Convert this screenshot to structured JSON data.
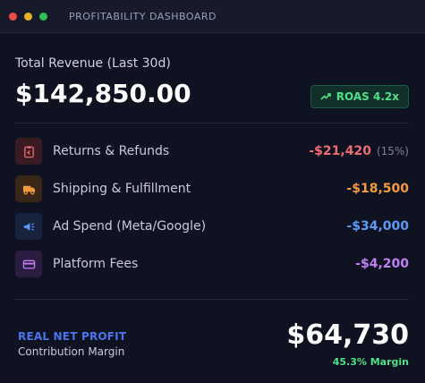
{
  "window": {
    "title": "PROFITABILITY DASHBOARD"
  },
  "summary": {
    "total_label": "Total Revenue (Last 30d)",
    "total_value": "$142,850.00",
    "roas_label": "ROAS 4.2x"
  },
  "costs": [
    {
      "label": "Returns & Refunds",
      "amount": "-$21,420",
      "pct": "(15%)",
      "icon": "return-receipt-icon",
      "color": "#ef6b73"
    },
    {
      "label": "Shipping & Fulfillment",
      "amount": "-$18,500",
      "icon": "truck-icon",
      "color": "#f59a3f"
    },
    {
      "label": "Ad Spend (Meta/Google)",
      "amount": "-$34,000",
      "icon": "megaphone-icon",
      "color": "#5b9bf5"
    },
    {
      "label": "Platform Fees",
      "amount": "-$4,200",
      "icon": "credit-card-icon",
      "color": "#c27ef5"
    }
  ],
  "net": {
    "label": "REAL NET PROFIT",
    "sublabel": "Contribution Margin",
    "value": "$64,730",
    "margin": "45.3% Margin"
  },
  "colors": {
    "background": "#0f1220",
    "accent_green": "#4ee08a",
    "accent_blue": "#4a74f0"
  }
}
